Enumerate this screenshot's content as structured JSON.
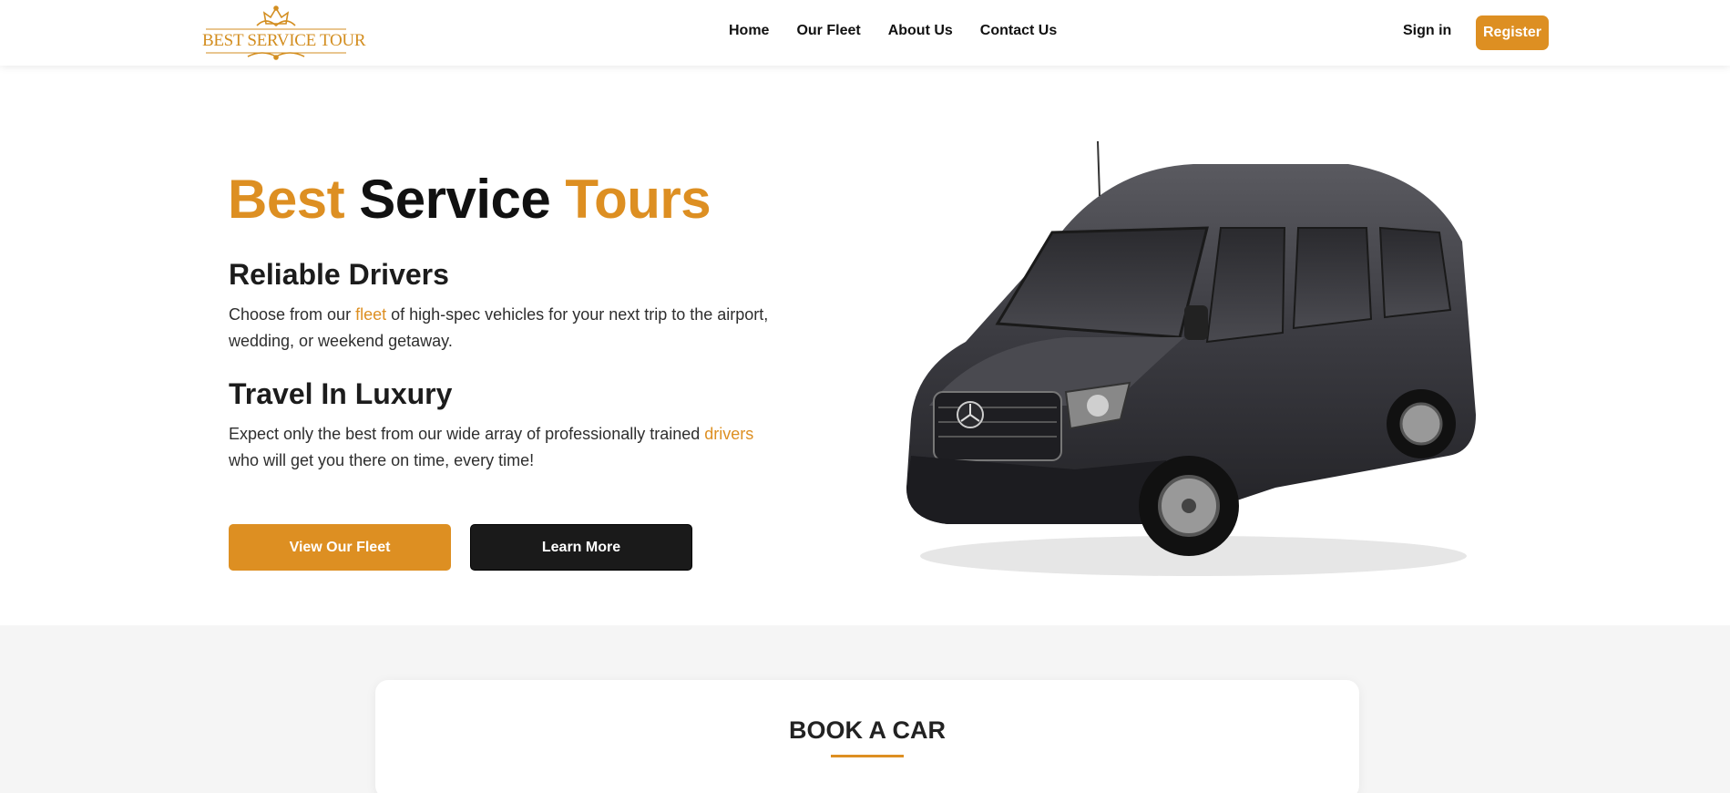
{
  "brand": {
    "logo_text": "BEST SERVICE TOUR",
    "accent_color": "#dd8f22"
  },
  "nav": {
    "items": [
      {
        "label": "Home"
      },
      {
        "label": "Our Fleet"
      },
      {
        "label": "About Us"
      },
      {
        "label": "Contact Us"
      }
    ],
    "sign_in": "Sign in",
    "register": "Register"
  },
  "hero": {
    "title_word1": "Best",
    "title_word2": "Service",
    "title_word3": "Tours",
    "section1": {
      "heading": "Reliable Drivers",
      "text_before": "Choose from our ",
      "link": "fleet",
      "text_after": " of high-spec vehicles for your next trip to the airport, wedding, or weekend getaway."
    },
    "section2": {
      "heading": "Travel In Luxury",
      "text_before": "Expect only the best from our wide array of professionally trained ",
      "link": "drivers",
      "text_after": " who will get you there on time, every time!"
    },
    "buttons": {
      "primary": "View Our Fleet",
      "secondary": "Learn More"
    },
    "image": "black-passenger-van"
  },
  "booking": {
    "title": "BOOK A CAR"
  }
}
